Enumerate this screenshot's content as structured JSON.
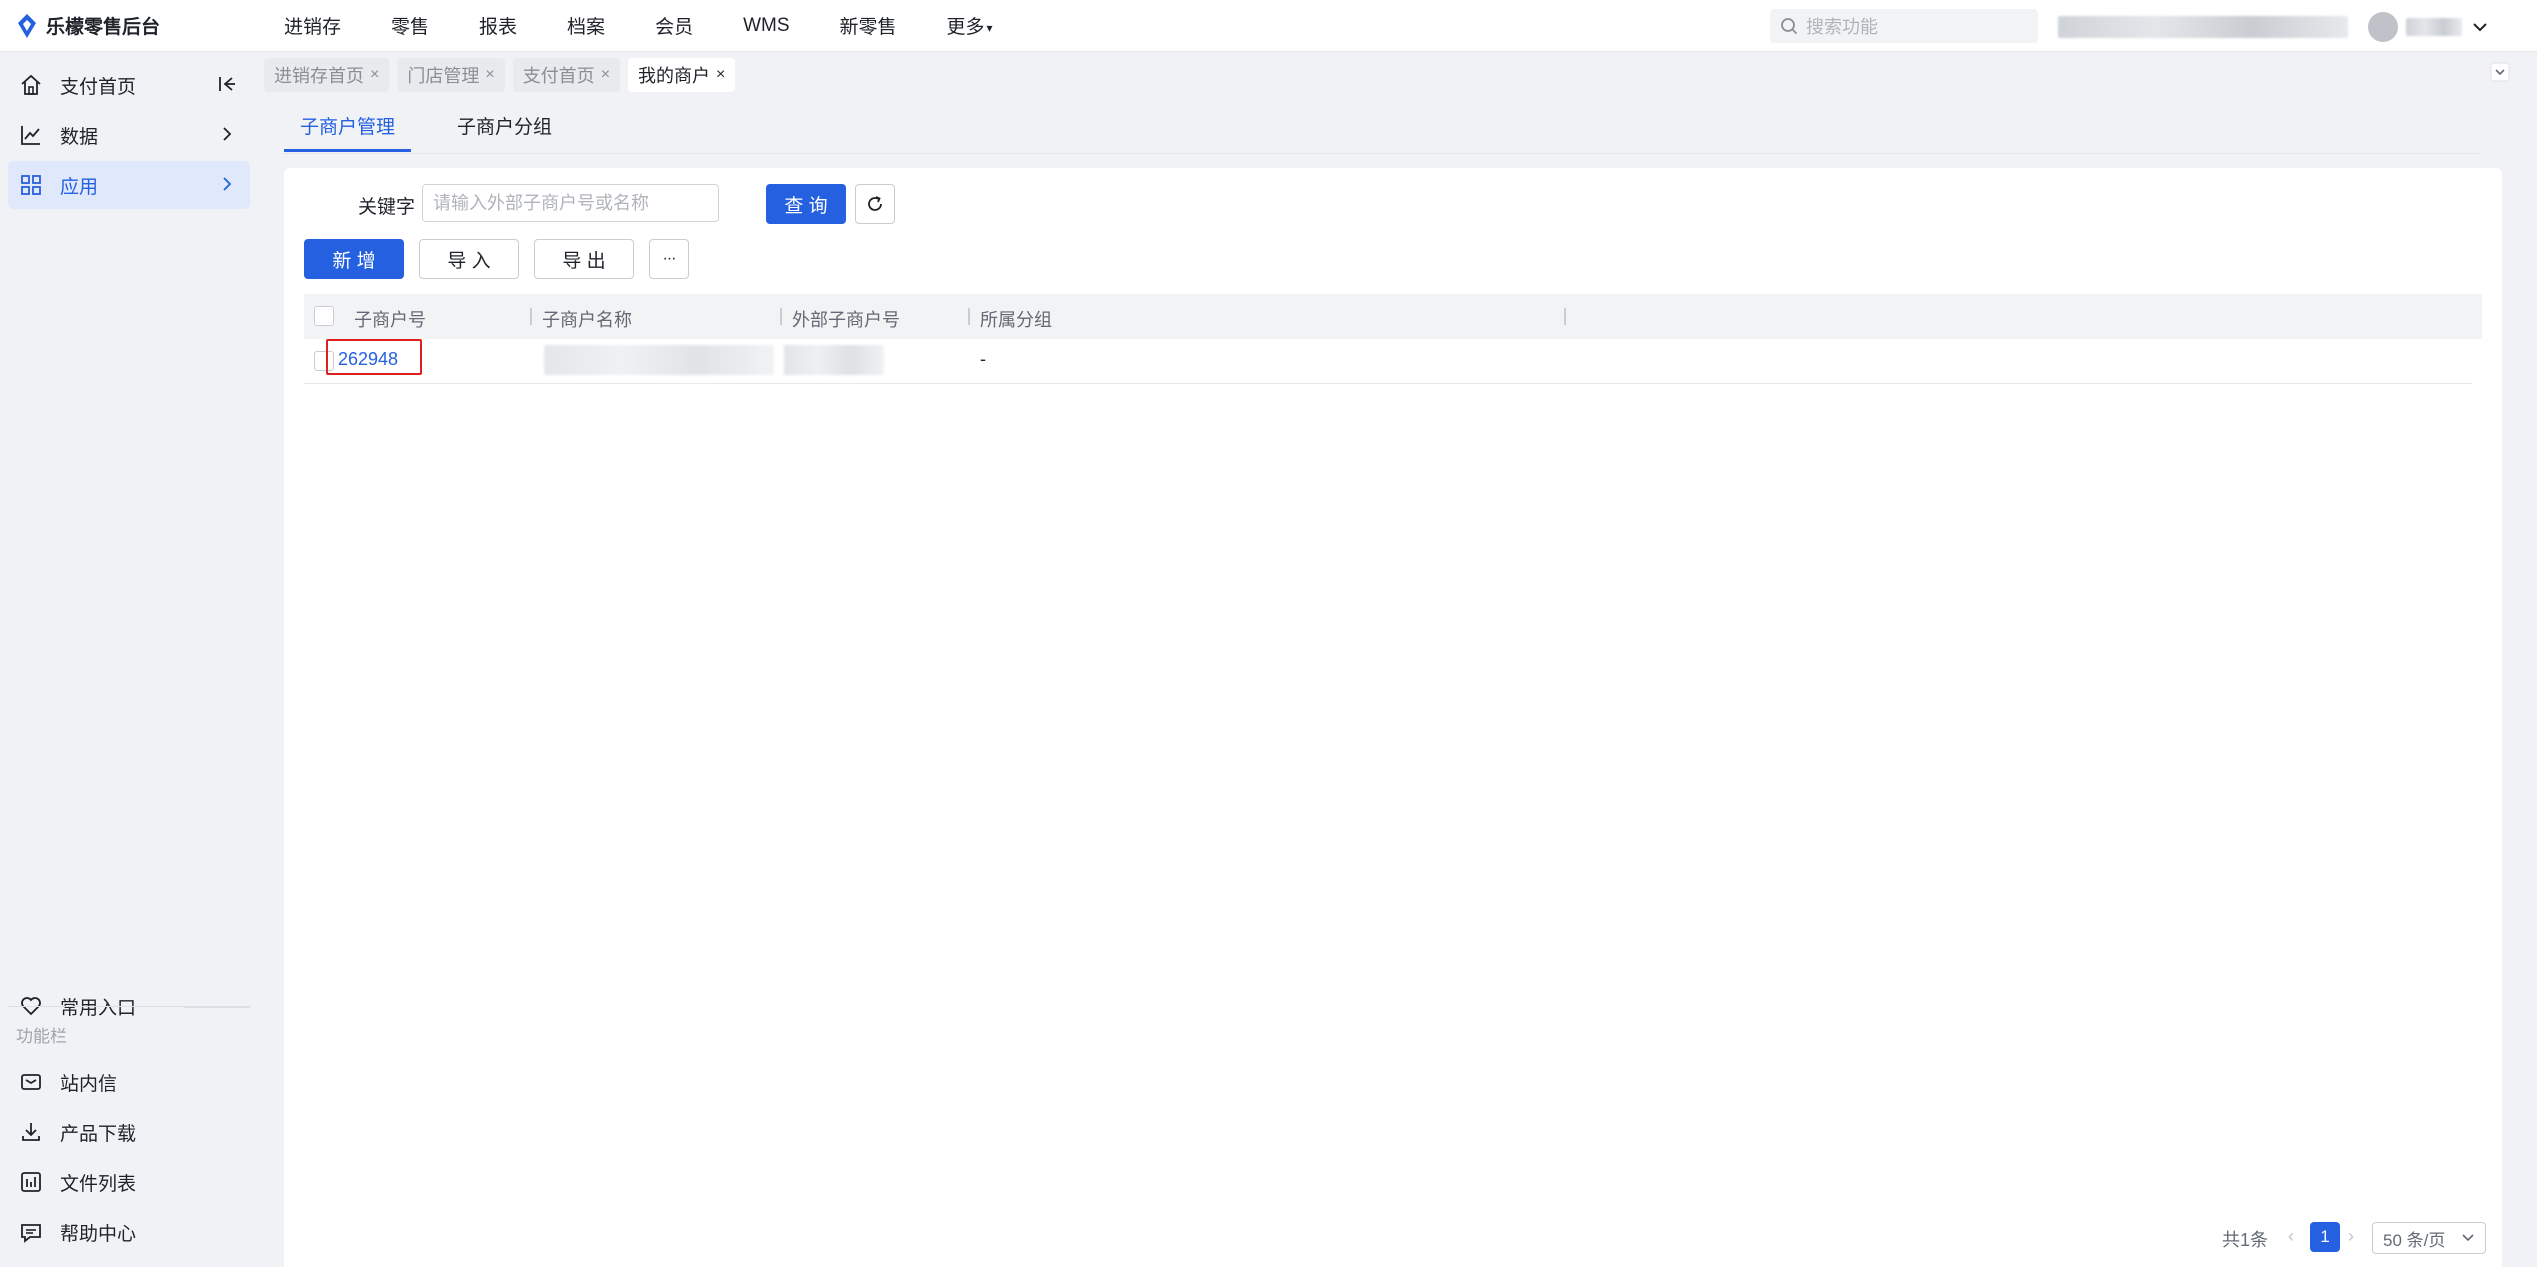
{
  "app": {
    "title": "乐檬零售后台",
    "brand_color": "#2560e0"
  },
  "topnav": {
    "items": [
      "进销存",
      "零售",
      "报表",
      "档案",
      "会员",
      "WMS",
      "新零售",
      "更多"
    ],
    "search_placeholder": "搜索功能"
  },
  "sidebar": {
    "items": [
      {
        "label": "支付首页",
        "icon": "home-icon"
      },
      {
        "label": "数据",
        "icon": "chart-icon"
      },
      {
        "label": "应用",
        "icon": "grid-apps-icon"
      }
    ],
    "bottom": {
      "common_entry": "常用入口",
      "section_label": "功能栏",
      "items": [
        {
          "label": "站内信",
          "icon": "mail-icon"
        },
        {
          "label": "产品下载",
          "icon": "download-icon"
        },
        {
          "label": "文件列表",
          "icon": "file-list-icon"
        },
        {
          "label": "帮助中心",
          "icon": "help-chat-icon"
        }
      ]
    }
  },
  "tabs": [
    "进销存首页",
    "门店管理",
    "支付首页",
    "我的商户"
  ],
  "active_tab": "我的商户",
  "subtabs": [
    "子商户管理",
    "子商户分组"
  ],
  "active_subtab": "子商户管理",
  "filters": {
    "keyword_label": "关键字",
    "keyword_placeholder": "请输入外部子商户号或名称",
    "keyword_value": "",
    "query_label": "查 询"
  },
  "toolbar": {
    "add_label": "新 增",
    "import_label": "导 入",
    "export_label": "导 出",
    "more_label": "···"
  },
  "table": {
    "columns": [
      "子商户号",
      "子商户名称",
      "外部子商户号",
      "所属分组"
    ],
    "rows": [
      {
        "id": "262948",
        "name": "",
        "external_id": "",
        "group": "-"
      }
    ]
  },
  "pagination": {
    "total": "共1条",
    "current_page": "1",
    "page_size": "50 条/页"
  }
}
